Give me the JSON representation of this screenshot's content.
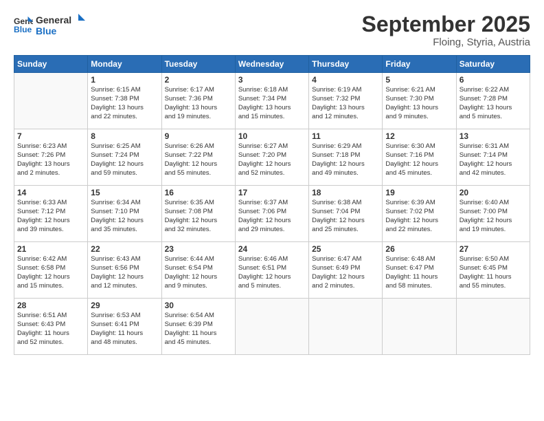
{
  "logo": {
    "line1": "General",
    "line2": "Blue"
  },
  "title": "September 2025",
  "location": "Floing, Styria, Austria",
  "days_of_week": [
    "Sunday",
    "Monday",
    "Tuesday",
    "Wednesday",
    "Thursday",
    "Friday",
    "Saturday"
  ],
  "weeks": [
    [
      {
        "day": "",
        "info": ""
      },
      {
        "day": "1",
        "info": "Sunrise: 6:15 AM\nSunset: 7:38 PM\nDaylight: 13 hours\nand 22 minutes."
      },
      {
        "day": "2",
        "info": "Sunrise: 6:17 AM\nSunset: 7:36 PM\nDaylight: 13 hours\nand 19 minutes."
      },
      {
        "day": "3",
        "info": "Sunrise: 6:18 AM\nSunset: 7:34 PM\nDaylight: 13 hours\nand 15 minutes."
      },
      {
        "day": "4",
        "info": "Sunrise: 6:19 AM\nSunset: 7:32 PM\nDaylight: 13 hours\nand 12 minutes."
      },
      {
        "day": "5",
        "info": "Sunrise: 6:21 AM\nSunset: 7:30 PM\nDaylight: 13 hours\nand 9 minutes."
      },
      {
        "day": "6",
        "info": "Sunrise: 6:22 AM\nSunset: 7:28 PM\nDaylight: 13 hours\nand 5 minutes."
      }
    ],
    [
      {
        "day": "7",
        "info": "Sunrise: 6:23 AM\nSunset: 7:26 PM\nDaylight: 13 hours\nand 2 minutes."
      },
      {
        "day": "8",
        "info": "Sunrise: 6:25 AM\nSunset: 7:24 PM\nDaylight: 12 hours\nand 59 minutes."
      },
      {
        "day": "9",
        "info": "Sunrise: 6:26 AM\nSunset: 7:22 PM\nDaylight: 12 hours\nand 55 minutes."
      },
      {
        "day": "10",
        "info": "Sunrise: 6:27 AM\nSunset: 7:20 PM\nDaylight: 12 hours\nand 52 minutes."
      },
      {
        "day": "11",
        "info": "Sunrise: 6:29 AM\nSunset: 7:18 PM\nDaylight: 12 hours\nand 49 minutes."
      },
      {
        "day": "12",
        "info": "Sunrise: 6:30 AM\nSunset: 7:16 PM\nDaylight: 12 hours\nand 45 minutes."
      },
      {
        "day": "13",
        "info": "Sunrise: 6:31 AM\nSunset: 7:14 PM\nDaylight: 12 hours\nand 42 minutes."
      }
    ],
    [
      {
        "day": "14",
        "info": "Sunrise: 6:33 AM\nSunset: 7:12 PM\nDaylight: 12 hours\nand 39 minutes."
      },
      {
        "day": "15",
        "info": "Sunrise: 6:34 AM\nSunset: 7:10 PM\nDaylight: 12 hours\nand 35 minutes."
      },
      {
        "day": "16",
        "info": "Sunrise: 6:35 AM\nSunset: 7:08 PM\nDaylight: 12 hours\nand 32 minutes."
      },
      {
        "day": "17",
        "info": "Sunrise: 6:37 AM\nSunset: 7:06 PM\nDaylight: 12 hours\nand 29 minutes."
      },
      {
        "day": "18",
        "info": "Sunrise: 6:38 AM\nSunset: 7:04 PM\nDaylight: 12 hours\nand 25 minutes."
      },
      {
        "day": "19",
        "info": "Sunrise: 6:39 AM\nSunset: 7:02 PM\nDaylight: 12 hours\nand 22 minutes."
      },
      {
        "day": "20",
        "info": "Sunrise: 6:40 AM\nSunset: 7:00 PM\nDaylight: 12 hours\nand 19 minutes."
      }
    ],
    [
      {
        "day": "21",
        "info": "Sunrise: 6:42 AM\nSunset: 6:58 PM\nDaylight: 12 hours\nand 15 minutes."
      },
      {
        "day": "22",
        "info": "Sunrise: 6:43 AM\nSunset: 6:56 PM\nDaylight: 12 hours\nand 12 minutes."
      },
      {
        "day": "23",
        "info": "Sunrise: 6:44 AM\nSunset: 6:54 PM\nDaylight: 12 hours\nand 9 minutes."
      },
      {
        "day": "24",
        "info": "Sunrise: 6:46 AM\nSunset: 6:51 PM\nDaylight: 12 hours\nand 5 minutes."
      },
      {
        "day": "25",
        "info": "Sunrise: 6:47 AM\nSunset: 6:49 PM\nDaylight: 12 hours\nand 2 minutes."
      },
      {
        "day": "26",
        "info": "Sunrise: 6:48 AM\nSunset: 6:47 PM\nDaylight: 11 hours\nand 58 minutes."
      },
      {
        "day": "27",
        "info": "Sunrise: 6:50 AM\nSunset: 6:45 PM\nDaylight: 11 hours\nand 55 minutes."
      }
    ],
    [
      {
        "day": "28",
        "info": "Sunrise: 6:51 AM\nSunset: 6:43 PM\nDaylight: 11 hours\nand 52 minutes."
      },
      {
        "day": "29",
        "info": "Sunrise: 6:53 AM\nSunset: 6:41 PM\nDaylight: 11 hours\nand 48 minutes."
      },
      {
        "day": "30",
        "info": "Sunrise: 6:54 AM\nSunset: 6:39 PM\nDaylight: 11 hours\nand 45 minutes."
      },
      {
        "day": "",
        "info": ""
      },
      {
        "day": "",
        "info": ""
      },
      {
        "day": "",
        "info": ""
      },
      {
        "day": "",
        "info": ""
      }
    ]
  ]
}
